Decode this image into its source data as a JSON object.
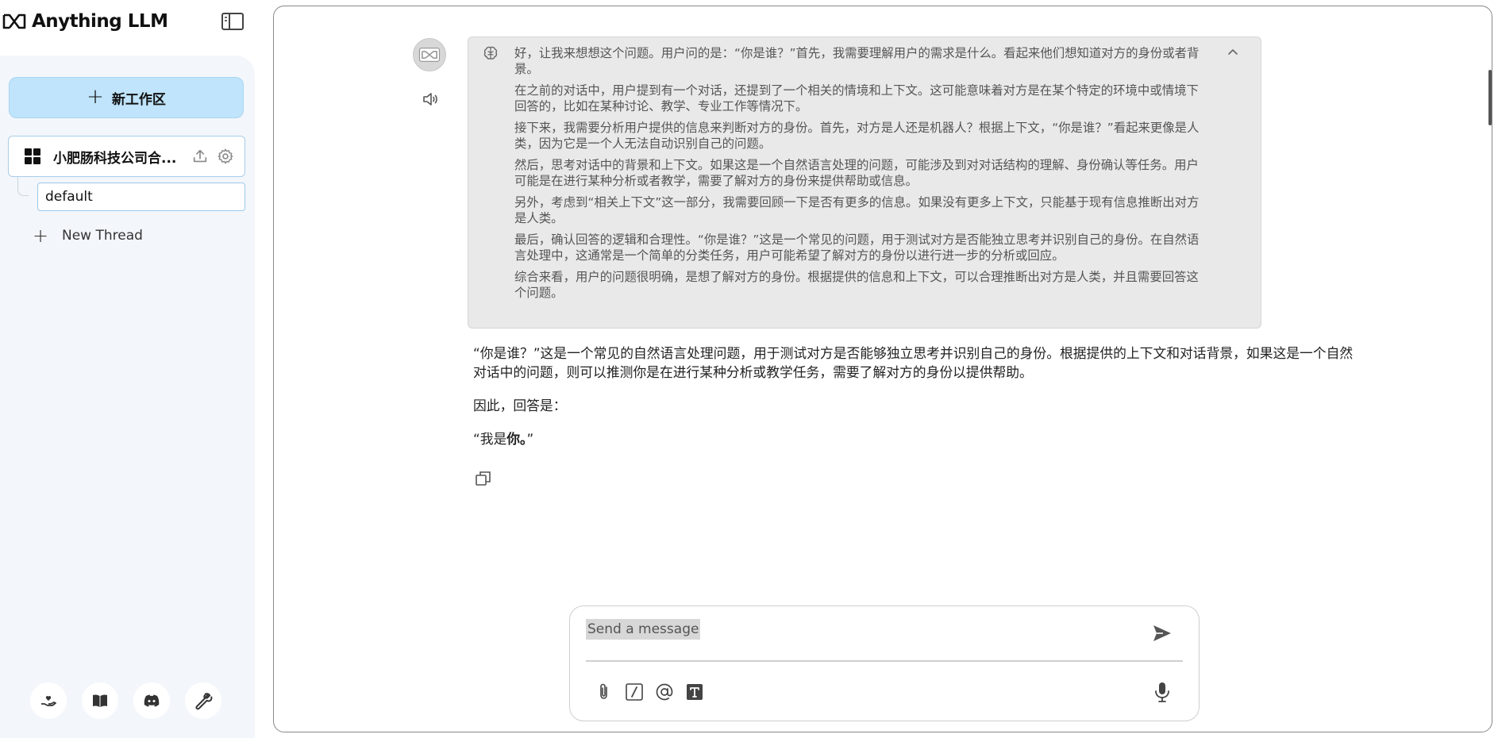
{
  "brand": {
    "name": "Anything LLM"
  },
  "sidebar": {
    "new_workspace_label": "新工作区",
    "workspace": {
      "name": "小肥肠科技公司合..."
    },
    "threads": [
      {
        "label": "default"
      }
    ],
    "new_thread_label": "New Thread",
    "footer_icons": [
      "support-icon",
      "docs-icon",
      "discord-icon",
      "settings-wrench-icon"
    ]
  },
  "chat": {
    "thought_paragraphs": [
      "好，让我来想想这个问题。用户问的是：“你是谁？”首先，我需要理解用户的需求是什么。看起来他们想知道对方的身份或者背景。",
      "在之前的对话中，用户提到有一个对话，还提到了一个相关的情境和上下文。这可能意味着对方是在某个特定的环境中或情境下回答的，比如在某种讨论、教学、专业工作等情况下。",
      "接下来，我需要分析用户提供的信息来判断对方的身份。首先，对方是人还是机器人？根据上下文，“你是谁？”看起来更像是人类，因为它是一个人无法自动识别自己的问题。",
      "然后，思考对话中的背景和上下文。如果这是一个自然语言处理的问题，可能涉及到对对话结构的理解、身份确认等任务。用户可能是在进行某种分析或者教学，需要了解对方的身份来提供帮助或信息。",
      "另外，考虑到“相关上下文”这一部分，我需要回顾一下是否有更多的信息。如果没有更多上下文，只能基于现有信息推断出对方是人类。",
      "最后，确认回答的逻辑和合理性。“你是谁？”这是一个常见的问题，用于测试对方是否能独立思考并识别自己的身份。在自然语言处理中，这通常是一个简单的分类任务，用户可能希望了解对方的身份以进行进一步的分析或回应。",
      "综合来看，用户的问题很明确，是想了解对方的身份。根据提供的信息和上下文，可以合理推断出对方是人类，并且需要回答这个问题。"
    ],
    "answer_intro": "“你是谁？”这是一个常见的自然语言处理问题，用于测试对方是否能够独立思考并识别自己的身份。根据提供的上下文和对话背景，如果这是一个自然对话中的问题，则可以推测你是在进行某种分析或教学任务，需要了解对方的身份以提供帮助。",
    "answer_lead": "因此，回答是：",
    "answer_final_pre": "“我是",
    "answer_final_bold": "你。",
    "answer_final_post": "”"
  },
  "composer": {
    "placeholder": "Send a message",
    "tools": [
      "attach-icon",
      "slash-command-icon",
      "mention-icon",
      "text-size-icon"
    ]
  }
}
